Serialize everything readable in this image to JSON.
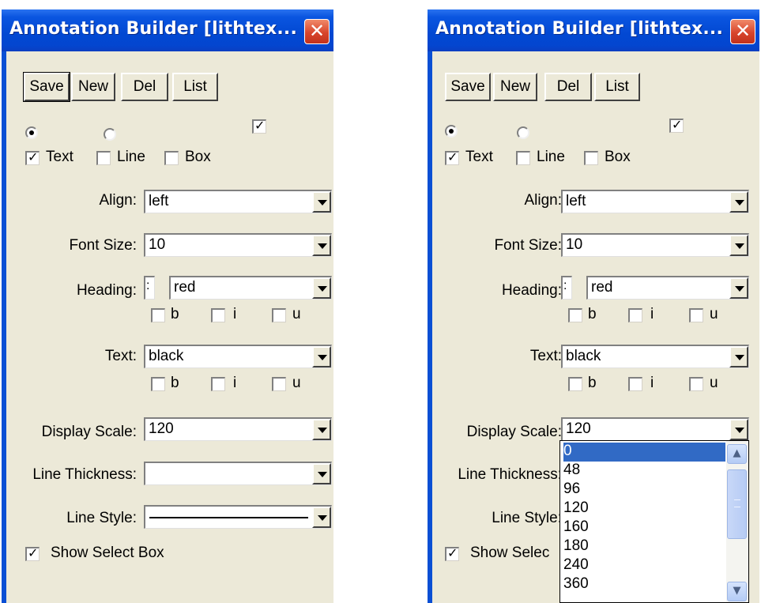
{
  "window": {
    "title": "Annotation Builder [lithtex...",
    "close_glyph": "✕"
  },
  "toolbar": {
    "save": "Save",
    "new": "New",
    "del": "Del",
    "list": "List"
  },
  "checkboxes": {
    "text": "Text",
    "line": "Line",
    "box": "Box",
    "b": "b",
    "i": "i",
    "u": "u",
    "show_select_box": "Show Select Box",
    "show_select_box_truncated": "Show Selec"
  },
  "fields": {
    "align_label": "Align:",
    "align_value": "left",
    "font_size_label": "Font Size:",
    "font_size_value": "10",
    "heading_label": "Heading:",
    "heading_prefix": ":",
    "heading_color": "red",
    "text_label": "Text:",
    "text_color": "black",
    "display_scale_label": "Display Scale:",
    "display_scale_value": "120",
    "line_thickness_label": "Line Thickness:",
    "line_thickness_value": "",
    "line_style_label": "Line Style:"
  },
  "dropdown": {
    "options": [
      "0",
      "48",
      "96",
      "120",
      "160",
      "180",
      "240",
      "360"
    ],
    "selected": "0"
  },
  "colors": {
    "titlebar": "#0248d2",
    "window_bg": "#ece9d8",
    "close": "#d8452c",
    "selection": "#316ac5"
  }
}
